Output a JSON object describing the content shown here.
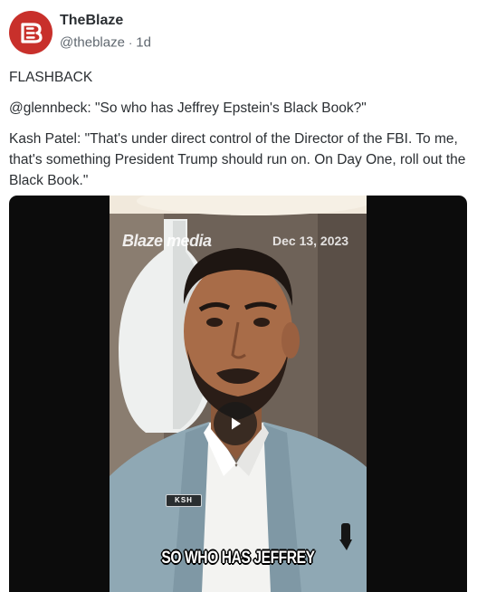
{
  "post": {
    "author_name": "TheBlaze",
    "handle": "@theblaze",
    "separator": "·",
    "time_ago": "1d",
    "avatar_icon": "blaze-logo-icon",
    "brand_color": "#c8302b",
    "text": {
      "line1": "FLASHBACK",
      "line2": "@glennbeck: \"So who has Jeffrey Epstein's Black Book?\"",
      "line3": "Kash Patel: \"That's under direct control of the Director of the FBI. To me, that's something President Trump should run on. On Day One, roll out the Black Book.\""
    },
    "video": {
      "watermark": "Blaze media",
      "date": "Dec 13, 2023",
      "pin_text": "KSH",
      "caption": "SO WHO HAS JEFFREY",
      "play_icon": "play-icon"
    }
  }
}
